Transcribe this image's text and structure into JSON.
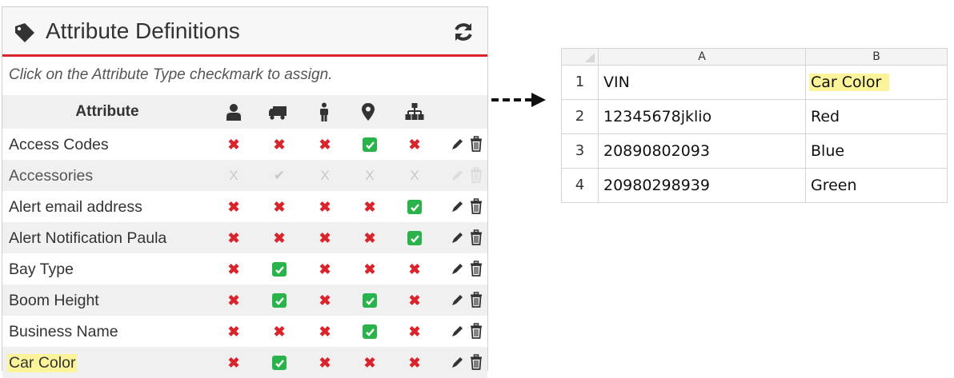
{
  "panel": {
    "title": "Attribute Definitions",
    "hint": "Click on the Attribute Type checkmark to assign.",
    "column_header": "Attribute",
    "type_icons": [
      "user-icon",
      "truck-icon",
      "person-icon",
      "map-marker-icon",
      "sitemap-icon"
    ],
    "rows": [
      {
        "name": "Access Codes",
        "states": [
          "x",
          "x",
          "x",
          "check",
          "x"
        ],
        "disabled": false,
        "highlight": false
      },
      {
        "name": "Accessories",
        "states": [
          "x",
          "check",
          "x",
          "x",
          "x"
        ],
        "disabled": true,
        "highlight": false
      },
      {
        "name": "Alert email address",
        "states": [
          "x",
          "x",
          "x",
          "x",
          "check"
        ],
        "disabled": false,
        "highlight": false
      },
      {
        "name": "Alert Notification Paula",
        "states": [
          "x",
          "x",
          "x",
          "x",
          "check"
        ],
        "disabled": false,
        "highlight": false
      },
      {
        "name": "Bay Type",
        "states": [
          "x",
          "check",
          "x",
          "x",
          "x"
        ],
        "disabled": false,
        "highlight": false
      },
      {
        "name": "Boom Height",
        "states": [
          "x",
          "check",
          "x",
          "check",
          "x"
        ],
        "disabled": false,
        "highlight": false
      },
      {
        "name": "Business Name",
        "states": [
          "x",
          "x",
          "x",
          "check",
          "x"
        ],
        "disabled": false,
        "highlight": false
      },
      {
        "name": "Car Color",
        "states": [
          "x",
          "check",
          "x",
          "x",
          "x"
        ],
        "disabled": false,
        "highlight": true
      }
    ],
    "colors": {
      "accent": "#d9242b",
      "check": "#2ab34a",
      "highlight": "#fbf49b"
    }
  },
  "sheet": {
    "columns": [
      "A",
      "B"
    ],
    "rows": [
      {
        "num": "1",
        "a": "VIN",
        "b": "Car Color",
        "b_highlight": true
      },
      {
        "num": "2",
        "a": "12345678jklio",
        "b": "Red",
        "b_highlight": false
      },
      {
        "num": "3",
        "a": "20890802093",
        "b": "Blue",
        "b_highlight": false
      },
      {
        "num": "4",
        "a": "20980298939",
        "b": "Green",
        "b_highlight": false
      }
    ]
  }
}
